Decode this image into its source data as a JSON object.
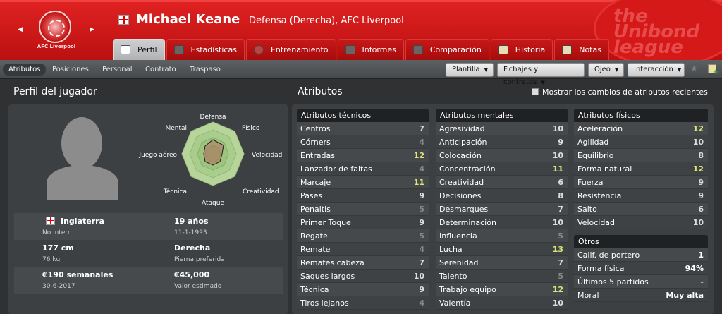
{
  "header": {
    "club_badge_text": "AFC Liverpool",
    "player_name": "Michael Keane",
    "player_desc": "Defensa (Derecha), AFC Liverpool",
    "logo_text": [
      "the",
      "Unibond",
      "league"
    ],
    "tabs": [
      {
        "label": "Perfil",
        "icon": "profile-icon",
        "active": true
      },
      {
        "label": "Estadísticas",
        "icon": "stats-icon"
      },
      {
        "label": "Entrenamiento",
        "icon": "training-icon"
      },
      {
        "label": "Informes",
        "icon": "reports-icon"
      },
      {
        "label": "Comparación",
        "icon": "comparison-icon"
      },
      {
        "label": "Historia",
        "icon": "history-icon"
      },
      {
        "label": "Notas",
        "icon": "notes-icon"
      }
    ]
  },
  "subnav": {
    "items": [
      "Atributos",
      "Posiciones",
      "Personal",
      "Contrato",
      "Traspaso"
    ],
    "active": "Atributos",
    "dropdowns": [
      "Plantilla",
      "Fichajes y contratos",
      "Ojeo",
      "Interacción"
    ]
  },
  "profile": {
    "title": "Perfil del jugador",
    "radar_labels": [
      "Defensa",
      "Físico",
      "Velocidad",
      "Creatividad",
      "Ataque",
      "Técnica",
      "Juego aéreo",
      "Mental"
    ],
    "nationality": "Inglaterra",
    "intl": "No intern.",
    "age": "19 años",
    "dob": "11-1-1993",
    "height": "177 cm",
    "weight": "76 kg",
    "foot": "Derecha",
    "foot_label": "Pierna preferida",
    "wage": "€190 semanales",
    "contract_end": "30-6-2017",
    "value": "€45,000",
    "value_label": "Valor estimado"
  },
  "attributes": {
    "title": "Atributos",
    "checkbox_label": "Mostrar los cambios de atributos recientes",
    "technical_title": "Atributos técnicos",
    "technical": [
      {
        "name": "Centros",
        "value": "7"
      },
      {
        "name": "Córners",
        "value": "4"
      },
      {
        "name": "Entradas",
        "value": "12"
      },
      {
        "name": "Lanzador de faltas",
        "value": "4"
      },
      {
        "name": "Marcaje",
        "value": "11"
      },
      {
        "name": "Pases",
        "value": "9"
      },
      {
        "name": "Penaltis",
        "value": "5"
      },
      {
        "name": "Primer Toque",
        "value": "9"
      },
      {
        "name": "Regate",
        "value": "5"
      },
      {
        "name": "Remate",
        "value": "4"
      },
      {
        "name": "Remates cabeza",
        "value": "7"
      },
      {
        "name": "Saques largos",
        "value": "10"
      },
      {
        "name": "Técnica",
        "value": "9"
      },
      {
        "name": "Tiros lejanos",
        "value": "4"
      }
    ],
    "mental_title": "Atributos mentales",
    "mental": [
      {
        "name": "Agresividad",
        "value": "10"
      },
      {
        "name": "Anticipación",
        "value": "9"
      },
      {
        "name": "Colocación",
        "value": "10"
      },
      {
        "name": "Concentración",
        "value": "11"
      },
      {
        "name": "Creatividad",
        "value": "6"
      },
      {
        "name": "Decisiones",
        "value": "8"
      },
      {
        "name": "Desmarques",
        "value": "7"
      },
      {
        "name": "Determinación",
        "value": "10"
      },
      {
        "name": "Influencia",
        "value": "5"
      },
      {
        "name": "Lucha",
        "value": "13"
      },
      {
        "name": "Serenidad",
        "value": "7"
      },
      {
        "name": "Talento",
        "value": "5"
      },
      {
        "name": "Trabajo equipo",
        "value": "12"
      },
      {
        "name": "Valentía",
        "value": "10"
      }
    ],
    "physical_title": "Atributos físicos",
    "physical": [
      {
        "name": "Aceleración",
        "value": "12"
      },
      {
        "name": "Agilidad",
        "value": "10"
      },
      {
        "name": "Equilibrio",
        "value": "8"
      },
      {
        "name": "Forma natural",
        "value": "12"
      },
      {
        "name": "Fuerza",
        "value": "9"
      },
      {
        "name": "Resistencia",
        "value": "9"
      },
      {
        "name": "Salto",
        "value": "6"
      },
      {
        "name": "Velocidad",
        "value": "10"
      }
    ],
    "other_title": "Otros",
    "other": [
      {
        "name": "Calif. de portero",
        "value": "1"
      },
      {
        "name": "Forma física",
        "value": "94%"
      },
      {
        "name": "Últimos 5 partidos",
        "value": "-"
      },
      {
        "name": "Moral",
        "value": "Muy alta"
      }
    ]
  },
  "colors": {
    "accent_red": "#d01515",
    "high_value": "#dfe47a",
    "low_value": "#888888"
  }
}
